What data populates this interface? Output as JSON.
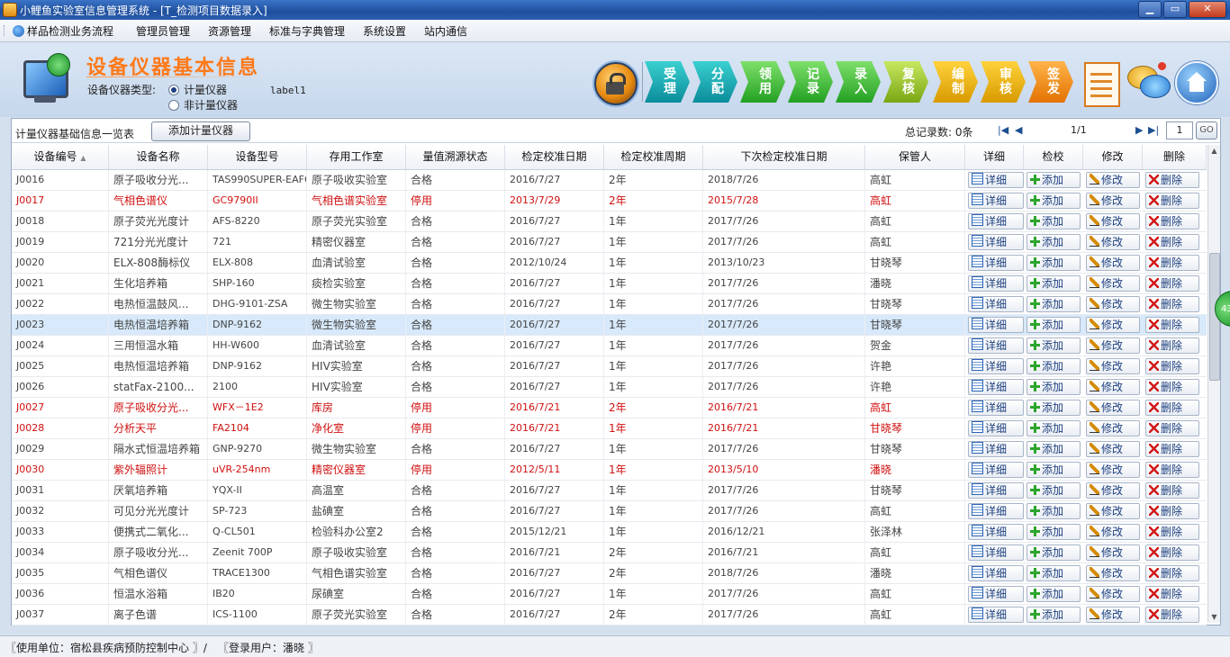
{
  "window": {
    "title": "小鲤鱼实验室信息管理系统 - [T_检测项目数据录入]",
    "buttons": {
      "minimize": "▁",
      "maximize": "▭",
      "close": "✕"
    }
  },
  "menu": {
    "items": [
      "样品检测业务流程",
      "管理员管理",
      "资源管理",
      "标准与字典管理",
      "系统设置",
      "站内通信"
    ]
  },
  "header": {
    "title": "设备仪器基本信息",
    "type_label": "设备仪器类型:",
    "radio_metering": "计量仪器",
    "radio_non_metering": "非计量仪器",
    "selected": "计量仪器",
    "label1": "label1"
  },
  "workflow": {
    "steps": [
      "受理",
      "分配",
      "领用",
      "记录",
      "录入",
      "复核",
      "编制",
      "审核",
      "签发"
    ],
    "step_colors": [
      "teal",
      "teal",
      "green",
      "green",
      "green",
      "lime",
      "gold",
      "gold",
      "orange"
    ]
  },
  "toolbar": {
    "list_title": "计量仪器基础信息一览表",
    "add_button": "添加计量仪器",
    "total": "总记录数: 0条",
    "page_info": "1/1",
    "page_input": "1",
    "go_button": "GO",
    "nav_first": "|◀",
    "nav_prev": "◀",
    "nav_next": "▶",
    "nav_last": "▶|"
  },
  "table": {
    "columns": [
      "设备编号",
      "设备名称",
      "设备型号",
      "存用工作室",
      "量值溯源状态",
      "检定校准日期",
      "检定校准周期",
      "下次检定校准日期",
      "保管人",
      "详细",
      "检校",
      "修改",
      "删除"
    ],
    "sort_indicator": "▲",
    "action_labels": {
      "detail": "详细",
      "add": "添加",
      "edit": "修改",
      "delete": "删除"
    },
    "rows": [
      {
        "id": "J0016",
        "name": "原子吸收分光...",
        "model": "TAS990SUPER-EAFG",
        "room": "原子吸收实验室",
        "status": "合格",
        "date": "2016/7/27",
        "period": "2年",
        "next": "2018/7/26",
        "keeper": "高虹",
        "red": false
      },
      {
        "id": "J0017",
        "name": "气相色谱仪",
        "model": "GC9790II",
        "room": "气相色谱实验室",
        "status": "停用",
        "date": "2013/7/29",
        "period": "2年",
        "next": "2015/7/28",
        "keeper": "高虹",
        "red": true
      },
      {
        "id": "J0018",
        "name": "原子荧光光度计",
        "model": "AFS-8220",
        "room": "原子荧光实验室",
        "status": "合格",
        "date": "2016/7/27",
        "period": "1年",
        "next": "2017/7/26",
        "keeper": "高虹",
        "red": false
      },
      {
        "id": "J0019",
        "name": "721分光光度计",
        "model": "721",
        "room": "精密仪器室",
        "status": "合格",
        "date": "2016/7/27",
        "period": "1年",
        "next": "2017/7/26",
        "keeper": "高虹",
        "red": false
      },
      {
        "id": "J0020",
        "name": "ELX-808酶标仪",
        "model": "ELX-808",
        "room": "血清试验室",
        "status": "合格",
        "date": "2012/10/24",
        "period": "1年",
        "next": "2013/10/23",
        "keeper": "甘晓琴",
        "red": false
      },
      {
        "id": "J0021",
        "name": "生化培养箱",
        "model": "SHP-160",
        "room": "痰检实验室",
        "status": "合格",
        "date": "2016/7/27",
        "period": "1年",
        "next": "2017/7/26",
        "keeper": "潘晓",
        "red": false
      },
      {
        "id": "J0022",
        "name": "电热恒温鼓风...",
        "model": "DHG-9101-ZSA",
        "room": "微生物实验室",
        "status": "合格",
        "date": "2016/7/27",
        "period": "1年",
        "next": "2017/7/26",
        "keeper": "甘晓琴",
        "red": false
      },
      {
        "id": "J0023",
        "name": "电热恒温培养箱",
        "model": "DNP-9162",
        "room": "微生物实验室",
        "status": "合格",
        "date": "2016/7/27",
        "period": "1年",
        "next": "2017/7/26",
        "keeper": "甘晓琴",
        "red": false,
        "selected": true
      },
      {
        "id": "J0024",
        "name": "三用恒温水箱",
        "model": "HH-W600",
        "room": "血清试验室",
        "status": "合格",
        "date": "2016/7/27",
        "period": "1年",
        "next": "2017/7/26",
        "keeper": "贺金",
        "red": false
      },
      {
        "id": "J0025",
        "name": "电热恒温培养箱",
        "model": "DNP-9162",
        "room": "HIV实验室",
        "status": "合格",
        "date": "2016/7/27",
        "period": "1年",
        "next": "2017/7/26",
        "keeper": "许艳",
        "red": false
      },
      {
        "id": "J0026",
        "name": "statFax-2100...",
        "model": "2100",
        "room": "HIV实验室",
        "status": "合格",
        "date": "2016/7/27",
        "period": "1年",
        "next": "2017/7/26",
        "keeper": "许艳",
        "red": false
      },
      {
        "id": "J0027",
        "name": "原子吸收分光...",
        "model": "WFX－1E2",
        "room": "库房",
        "status": "停用",
        "date": "2016/7/21",
        "period": "2年",
        "next": "2016/7/21",
        "keeper": "高虹",
        "red": true
      },
      {
        "id": "J0028",
        "name": "分析天平",
        "model": "FA2104",
        "room": "净化室",
        "status": "停用",
        "date": "2016/7/21",
        "period": "1年",
        "next": "2016/7/21",
        "keeper": "甘晓琴",
        "red": true
      },
      {
        "id": "J0029",
        "name": "隔水式恒温培养箱",
        "model": "GNP-9270",
        "room": "微生物实验室",
        "status": "合格",
        "date": "2016/7/27",
        "period": "1年",
        "next": "2017/7/26",
        "keeper": "甘晓琴",
        "red": false
      },
      {
        "id": "J0030",
        "name": "紫外辐照计",
        "model": "uVR-254nm",
        "room": "精密仪器室",
        "status": "停用",
        "date": "2012/5/11",
        "period": "1年",
        "next": "2013/5/10",
        "keeper": "潘晓",
        "red": true
      },
      {
        "id": "J0031",
        "name": "厌氧培养箱",
        "model": "YQX-II",
        "room": "高温室",
        "status": "合格",
        "date": "2016/7/27",
        "period": "1年",
        "next": "2017/7/26",
        "keeper": "甘晓琴",
        "red": false
      },
      {
        "id": "J0032",
        "name": "可见分光光度计",
        "model": "SP-723",
        "room": "盐碘室",
        "status": "合格",
        "date": "2016/7/27",
        "period": "1年",
        "next": "2017/7/26",
        "keeper": "高虹",
        "red": false
      },
      {
        "id": "J0033",
        "name": "便携式二氧化...",
        "model": "Q-CL501",
        "room": "检验科办公室2",
        "status": "合格",
        "date": "2015/12/21",
        "period": "1年",
        "next": "2016/12/21",
        "keeper": "张泽林",
        "red": false
      },
      {
        "id": "J0034",
        "name": "原子吸收分光...",
        "model": "Zeenit 700P",
        "room": "原子吸收实验室",
        "status": "合格",
        "date": "2016/7/21",
        "period": "2年",
        "next": "2016/7/21",
        "keeper": "高虹",
        "red": false
      },
      {
        "id": "J0035",
        "name": "气相色谱仪",
        "model": "TRACE1300",
        "room": "气相色谱实验室",
        "status": "合格",
        "date": "2016/7/27",
        "period": "2年",
        "next": "2018/7/26",
        "keeper": "潘晓",
        "red": false
      },
      {
        "id": "J0036",
        "name": "恒温水浴箱",
        "model": "IB20",
        "room": "尿碘室",
        "status": "合格",
        "date": "2016/7/27",
        "period": "1年",
        "next": "2017/7/26",
        "keeper": "高虹",
        "red": false
      },
      {
        "id": "J0037",
        "name": "离子色谱",
        "model": "ICS-1100",
        "room": "原子荧光实验室",
        "status": "合格",
        "date": "2016/7/27",
        "period": "2年",
        "next": "2017/7/26",
        "keeper": "高虹",
        "red": false
      }
    ]
  },
  "side_bubble": "43",
  "statusbar": {
    "unit": "〖使用单位：宿松县疾病预防控制中心 〗/",
    "user": "〖登录用户：潘晓 〗"
  },
  "colors": {
    "accent": "#ff7a1a",
    "red_row": "#d01010",
    "selected_row": "#d7e9fa"
  }
}
